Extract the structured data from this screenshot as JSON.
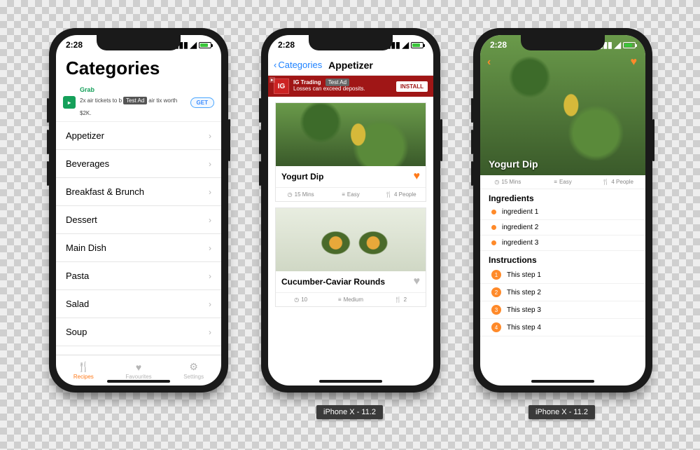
{
  "status_time": "2:28",
  "phone1": {
    "title": "Categories",
    "ad": {
      "brand": "Grab",
      "text_a": "2x air tickets to b",
      "text_b": "air tix worth $2K.",
      "badge": "Test Ad",
      "cta": "GET"
    },
    "items": [
      "Appetizer",
      "Beverages",
      "Breakfast & Brunch",
      "Dessert",
      "Main Dish",
      "Pasta",
      "Salad",
      "Soup"
    ],
    "tabs": [
      {
        "icon": "🍴",
        "label": "Recipes"
      },
      {
        "icon": "♥",
        "label": "Favourites"
      },
      {
        "icon": "⚙",
        "label": "Settings"
      }
    ]
  },
  "phone2": {
    "back": "Categories",
    "title": "Appetizer",
    "ad": {
      "brand": "IG",
      "line1": "IG Trading",
      "line2": "Losses can exceed deposits.",
      "badge": "Test Ad",
      "cta": "INSTALL"
    },
    "cards": [
      {
        "title": "Yogurt Dip",
        "fav": true,
        "time": "15 Mins",
        "diff": "Easy",
        "serves": "4 People"
      },
      {
        "title": "Cucumber-Caviar Rounds",
        "fav": false,
        "time": "10",
        "diff": "Medium",
        "serves": "2"
      }
    ]
  },
  "phone3": {
    "title": "Yogurt Dip",
    "meta": {
      "time": "15 Mins",
      "diff": "Easy",
      "serves": "4 People"
    },
    "ing_header": "Ingredients",
    "ingredients": [
      "ingredient 1",
      "ingredient 2",
      "ingredient 3"
    ],
    "inst_header": "Instructions",
    "steps": [
      "This step 1",
      "This step 2",
      "This step 3",
      "This step 4"
    ]
  },
  "device_label": "iPhone X - 11.2"
}
